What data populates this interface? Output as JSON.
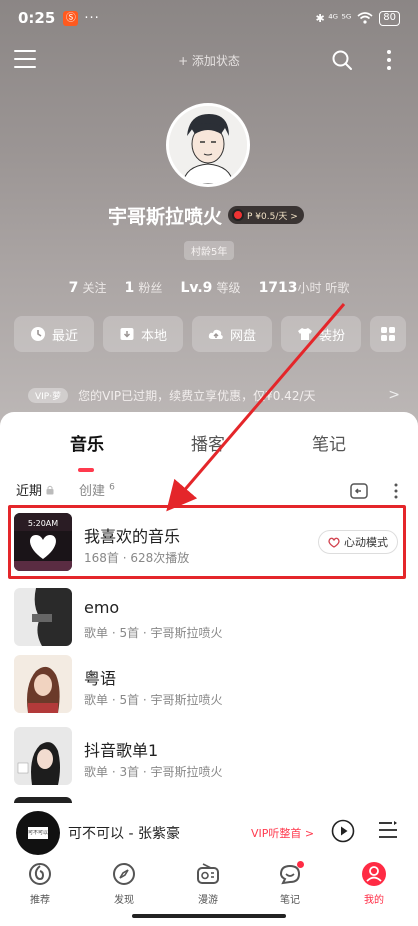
{
  "status_bar": {
    "time": "0:25",
    "app_badge": "Ⓢ",
    "dots": "···",
    "signals": "✱ ⁴ᴳ ⁵ᴳ",
    "battery": "80"
  },
  "header": {
    "add_status": "+ 添加状态"
  },
  "profile": {
    "username": "宇哥斯拉喷火",
    "vip_badge": "P ¥0.5/天 >",
    "age_tag": "村龄5年",
    "stats": [
      {
        "num": "7",
        "label": "关注"
      },
      {
        "num": "1",
        "label": "粉丝"
      },
      {
        "num": "Lv.9",
        "label": "等级"
      },
      {
        "num": "1713",
        "label": "小时 听歌"
      }
    ]
  },
  "quick_actions": [
    {
      "label": "最近",
      "icon": "clock-icon"
    },
    {
      "label": "本地",
      "icon": "download-box-icon"
    },
    {
      "label": "网盘",
      "icon": "cloud-upload-icon"
    },
    {
      "label": "装扮",
      "icon": "tshirt-icon"
    },
    {
      "label": "",
      "icon": "grid-icon"
    }
  ],
  "vip_banner": {
    "tag": "VIP·萝",
    "text": "您的VIP已过期，续费立享优惠，仅¥0.42/天",
    "arrow": ">"
  },
  "tabs": [
    "音乐",
    "播客",
    "笔记"
  ],
  "subtabs": {
    "recent": "近期",
    "created": "创建",
    "created_count": "6"
  },
  "playlists": [
    {
      "title": "我喜欢的音乐",
      "subtitle": "168首 · 628次播放",
      "cover_text": "5:20AM",
      "button": "心动模式"
    },
    {
      "title": "emo",
      "subtitle": "歌单 · 5首 · 宇哥斯拉喷火"
    },
    {
      "title": "粤语",
      "subtitle": "歌单 · 5首 · 宇哥斯拉喷火"
    },
    {
      "title": "抖音歌单1",
      "subtitle": "歌单 · 3首 · 宇哥斯拉喷火"
    }
  ],
  "mini_player": {
    "title": "可不可以 - 张紫豪",
    "vip": "VIP听整首 >",
    "disc_text": "可不可以"
  },
  "bottom_nav": [
    {
      "label": "推荐",
      "icon": "netease-icon"
    },
    {
      "label": "发现",
      "icon": "compass-icon"
    },
    {
      "label": "漫游",
      "icon": "radio-icon"
    },
    {
      "label": "笔记",
      "icon": "chat-bubble-icon"
    },
    {
      "label": "我的",
      "icon": "user-icon"
    }
  ],
  "colors": {
    "accent": "#ff3a4e",
    "highlight_border": "#e4262a"
  }
}
